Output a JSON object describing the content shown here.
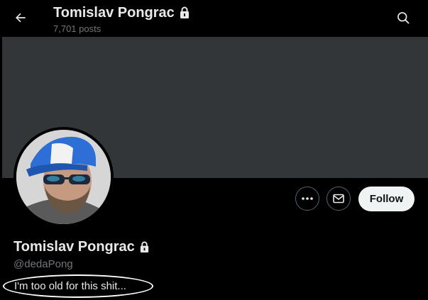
{
  "header": {
    "title": "Tomislav Pongrac",
    "posts_count": "7,701 posts"
  },
  "profile": {
    "name": "Tomislav Pongrac",
    "handle": "@dedaPong",
    "bio": "I'm too old for this shit...",
    "protected": true
  },
  "actions": {
    "follow_label": "Follow",
    "more_icon": "more-horizontal-icon",
    "message_icon": "envelope-icon"
  },
  "icons": {
    "back": "arrow-left-icon",
    "search": "search-icon",
    "lock": "lock-icon"
  },
  "colors": {
    "background": "#000000",
    "banner": "#333639",
    "primary_text": "#e7e9ea",
    "secondary_text": "#71767b",
    "follow_button": "#eff3f4"
  }
}
